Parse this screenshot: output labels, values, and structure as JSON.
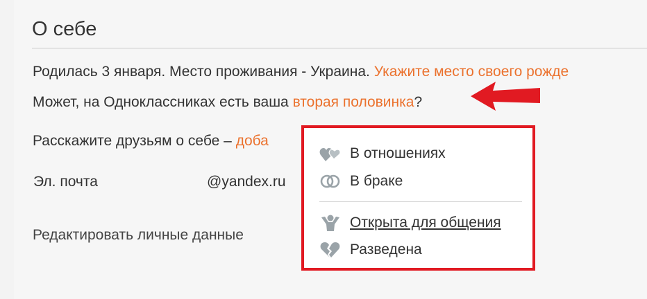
{
  "section": {
    "title": "О себе"
  },
  "about": {
    "line1_text": "Родилась 3 января. Место проживания - Украина. ",
    "line1_link": "Укажите место своего рожде",
    "line2_text": "Может, на Одноклассниках есть ваша ",
    "line2_link": "вторая половинка",
    "line2_suffix": "?",
    "line3_text": "Расскажите друзьям о себе – ",
    "line3_link": "доба"
  },
  "contact": {
    "email_label": "Эл. почта",
    "email_value": "@yandex.ru"
  },
  "actions": {
    "edit_label": "Редактировать личные данные"
  },
  "status_menu": {
    "items": [
      {
        "label": "В отношениях",
        "icon": "hearts-icon"
      },
      {
        "label": "В браке",
        "icon": "rings-icon"
      },
      {
        "label": "Открыта для общения",
        "icon": "person-open-icon"
      },
      {
        "label": "Разведена",
        "icon": "broken-heart-icon"
      }
    ]
  },
  "colors": {
    "link": "#eb722e",
    "highlight_border": "#e11a22",
    "arrow": "#e11a22",
    "icon": "#9aa3a8"
  }
}
